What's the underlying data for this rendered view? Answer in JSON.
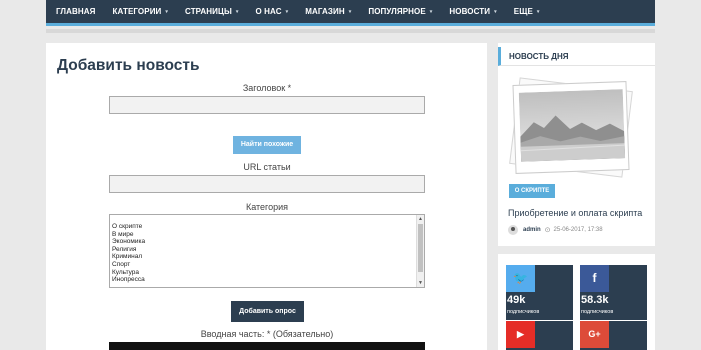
{
  "nav": {
    "items": [
      {
        "label": "ГЛАВНАЯ",
        "has_menu": false
      },
      {
        "label": "КАТЕГОРИИ",
        "has_menu": true
      },
      {
        "label": "СТРАНИЦЫ",
        "has_menu": true
      },
      {
        "label": "О НАС",
        "has_menu": true
      },
      {
        "label": "МАГАЗИН",
        "has_menu": true
      },
      {
        "label": "ПОПУЛЯРНОЕ",
        "has_menu": true
      },
      {
        "label": "НОВОСТИ",
        "has_menu": true
      },
      {
        "label": "ЕЩЕ",
        "has_menu": true
      }
    ],
    "caret": "▾"
  },
  "form": {
    "title": "Добавить новость",
    "title_field": {
      "label": "Заголовок *",
      "value": ""
    },
    "find_similar_button": "Найти похожие",
    "url_field": {
      "label": "URL статьи",
      "value": ""
    },
    "category": {
      "label": "Категория",
      "options": [
        "О скрипте",
        "В мире",
        "Экономика",
        "Религия",
        "Криминал",
        "Спорт",
        "Культура",
        "Инопресса"
      ]
    },
    "add_poll_button": "Добавить опрос",
    "intro_label": "Вводная часть: * (Обязательно)"
  },
  "sidebar": {
    "news_of_day": {
      "heading": "НОВОСТЬ ДНЯ",
      "tag": "О СКРИПТЕ",
      "title": "Приобретение и оплата скрипта",
      "author": "admin",
      "date": "25-06-2017, 17:38"
    },
    "social": [
      {
        "network": "twitter",
        "icon": "twitter-icon",
        "glyph": "🐦",
        "count": "49k",
        "caption": "подписчиков",
        "color": "#55acee"
      },
      {
        "network": "facebook",
        "icon": "facebook-icon",
        "glyph": "f",
        "count": "58.3k",
        "caption": "подписчиков",
        "color": "#3b5998"
      },
      {
        "network": "youtube",
        "icon": "youtube-icon",
        "glyph": "▶",
        "color": "#e52d27"
      },
      {
        "network": "google-plus",
        "icon": "google-plus-icon",
        "glyph": "G+",
        "color": "#dd4b39"
      }
    ]
  },
  "colors": {
    "nav_bg": "#2c3e50",
    "accent": "#5aaddb",
    "title": "#2c3e50"
  }
}
